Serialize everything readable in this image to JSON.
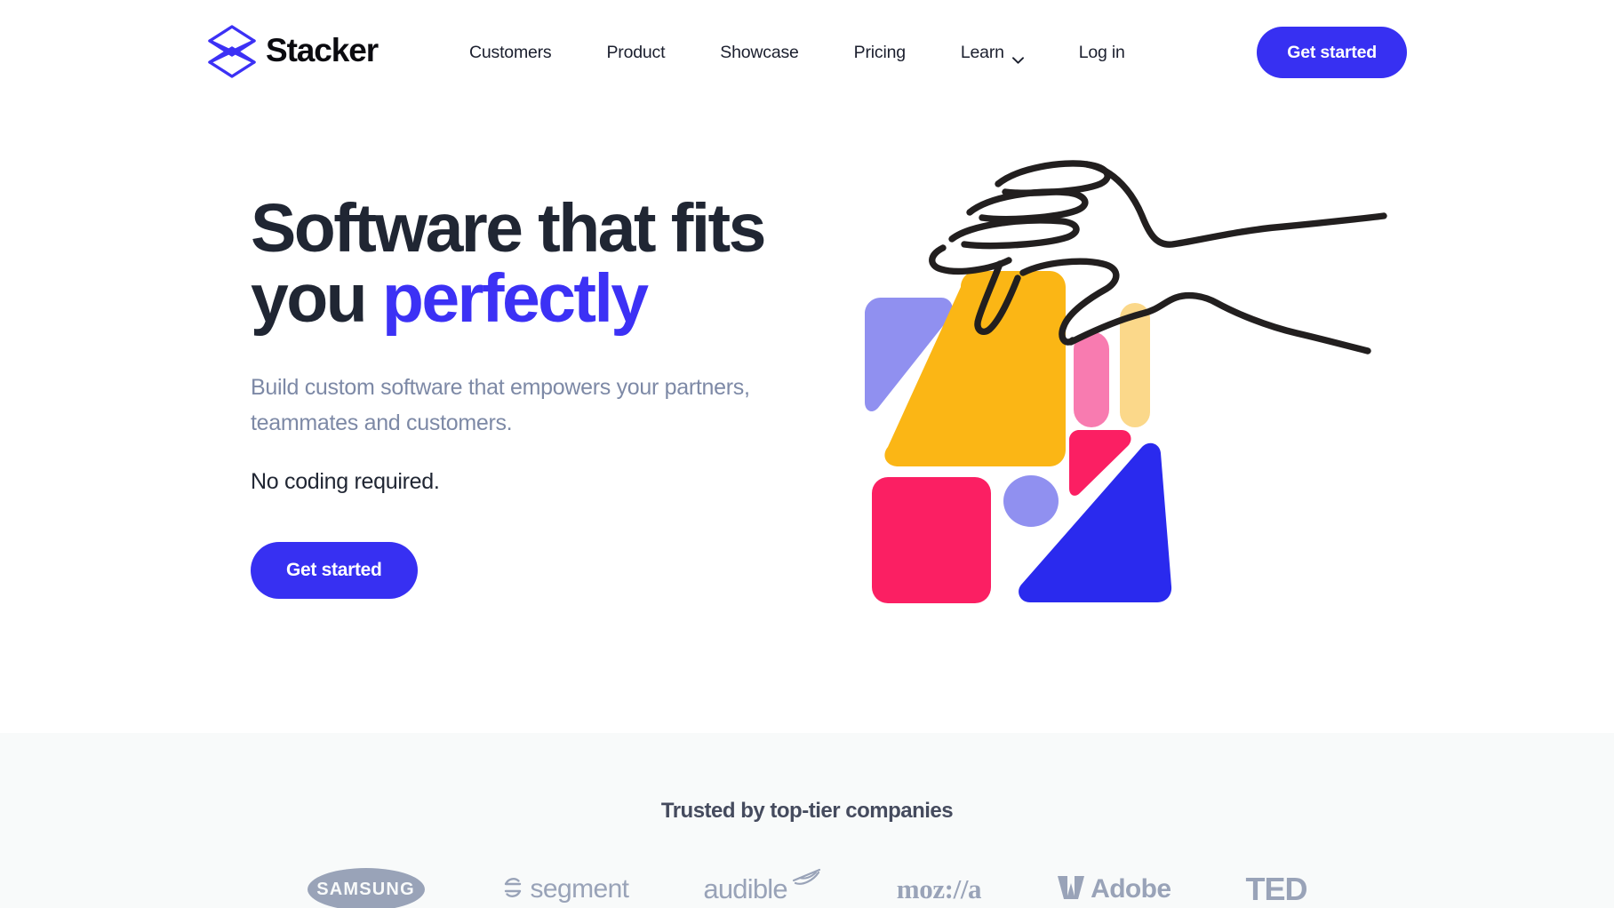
{
  "brand": {
    "name": "Stacker",
    "logo_icon": "stacker-diamonds-logo",
    "logo_color": "#3c31f5"
  },
  "header": {
    "nav": [
      {
        "label": "Customers",
        "icon": null
      },
      {
        "label": "Product",
        "icon": null
      },
      {
        "label": "Showcase",
        "icon": null
      },
      {
        "label": "Pricing",
        "icon": null
      },
      {
        "label": "Learn",
        "icon": "chevron-down-icon"
      },
      {
        "label": "Log in",
        "icon": null
      }
    ],
    "cta_label": "Get started",
    "cta_color": "#3730f2"
  },
  "hero": {
    "headline_line1": "Software that fits",
    "headline_line2_plain": "you ",
    "headline_line2_accent": "perfectly",
    "accent_color": "#3c31f5",
    "subcopy": "Build custom software that empowers your partners, teammates and customers.",
    "subcopy_strong": "No coding required.",
    "cta_label": "Get started",
    "illustration": {
      "name": "hand-reaching-over-abstract-shapes",
      "line_color": "#221f1f",
      "shapes": [
        {
          "name": "periwinkle-wedge",
          "color": "#9090f0"
        },
        {
          "name": "amber-quadrilateral",
          "color": "#fbb615"
        },
        {
          "name": "pink-pill",
          "color": "#f87bb0"
        },
        {
          "name": "cream-pill",
          "color": "#fbd88a"
        },
        {
          "name": "magenta-square",
          "color": "#fb1f63"
        },
        {
          "name": "magenta-triangle",
          "color": "#fb1f63"
        },
        {
          "name": "periwinkle-circle",
          "color": "#9090f0"
        },
        {
          "name": "blue-triangle",
          "color": "#2a2aee"
        }
      ]
    }
  },
  "trusted": {
    "title": "Trusted by top-tier companies",
    "logos": [
      {
        "name": "samsung-logo",
        "label": "SAMSUNG"
      },
      {
        "name": "segment-logo",
        "label": "segment"
      },
      {
        "name": "audible-logo",
        "label": "audible"
      },
      {
        "name": "mozilla-logo",
        "label": "moz://a"
      },
      {
        "name": "adobe-logo",
        "label": "Adobe"
      },
      {
        "name": "ted-logo",
        "label": "TED"
      }
    ],
    "background": "#f8fafa",
    "logo_color": "#99a3b8"
  }
}
